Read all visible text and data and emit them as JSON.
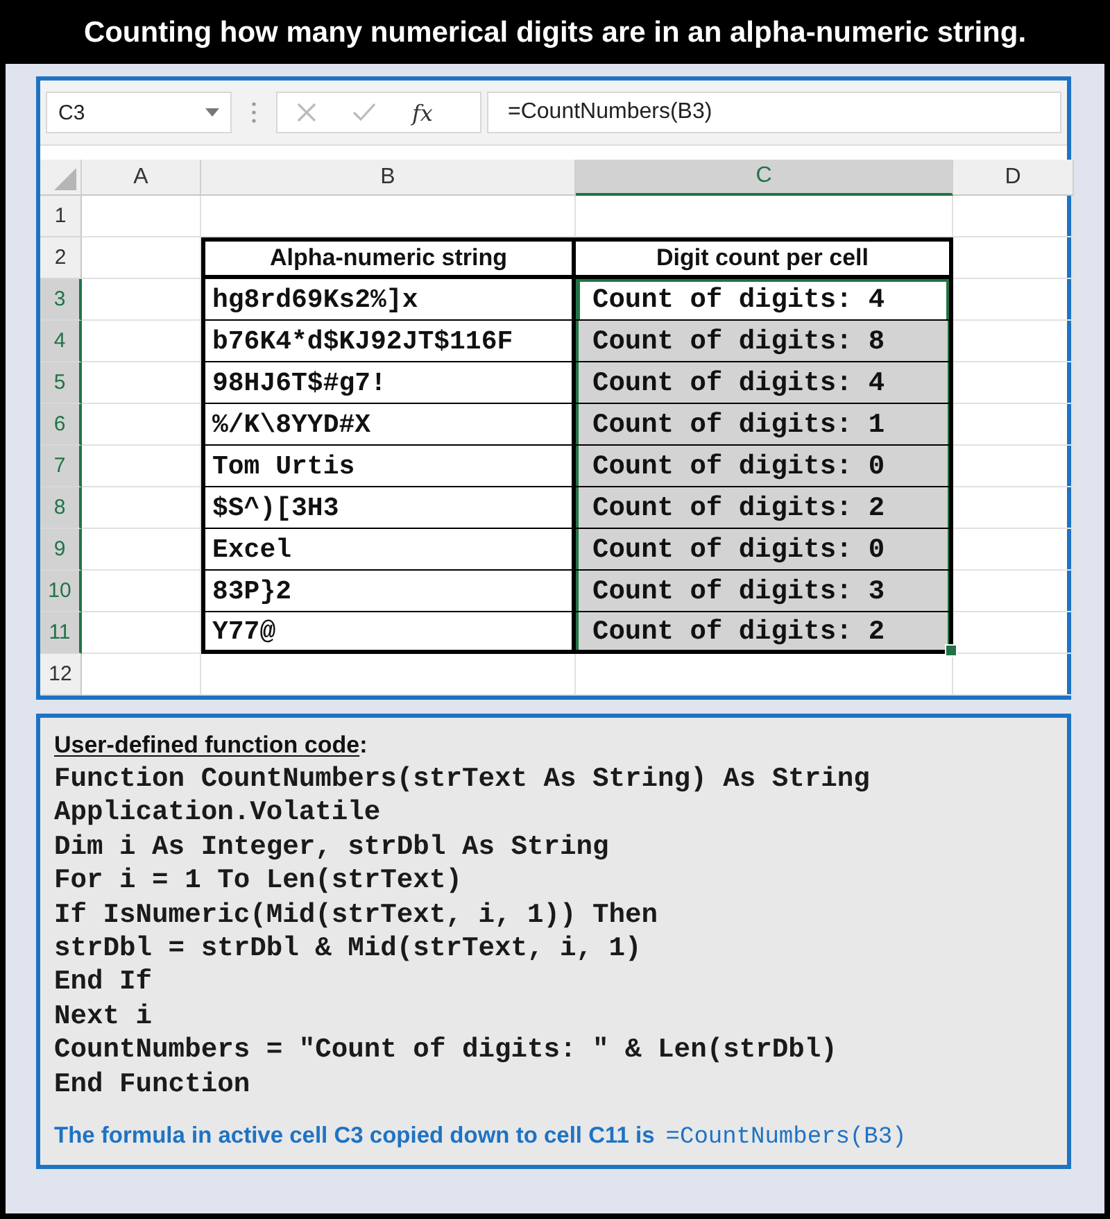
{
  "title": "Counting how many numerical digits are in an alpha-numeric string.",
  "formula_bar": {
    "name_box": "C3",
    "fx": "fx",
    "formula": "=CountNumbers(B3)"
  },
  "columns": [
    {
      "label": "A",
      "selected": false
    },
    {
      "label": "B",
      "selected": false
    },
    {
      "label": "C",
      "selected": true
    },
    {
      "label": "D",
      "selected": false
    }
  ],
  "rows": [
    {
      "number": "1",
      "kind": "empty",
      "selected": false
    },
    {
      "number": "2",
      "kind": "header",
      "selected": false,
      "cells": [
        "Alpha-numeric string",
        "Digit count per cell"
      ]
    },
    {
      "number": "3",
      "kind": "data",
      "selected": true,
      "active": true,
      "cells": [
        "hg8rd69Ks2%]x",
        "Count of digits: 4"
      ]
    },
    {
      "number": "4",
      "kind": "data",
      "selected": true,
      "active": false,
      "cells": [
        "b76K4*d$KJ92JT$116F",
        "Count of digits: 8"
      ]
    },
    {
      "number": "5",
      "kind": "data",
      "selected": true,
      "active": false,
      "cells": [
        "98HJ6T$#g7!",
        "Count of digits: 4"
      ]
    },
    {
      "number": "6",
      "kind": "data",
      "selected": true,
      "active": false,
      "cells": [
        "%/K\\8YYD#X",
        "Count of digits: 1"
      ]
    },
    {
      "number": "7",
      "kind": "data",
      "selected": true,
      "active": false,
      "cells": [
        "Tom Urtis",
        "Count of digits: 0"
      ]
    },
    {
      "number": "8",
      "kind": "data",
      "selected": true,
      "active": false,
      "cells": [
        "$S^)[3H3",
        "Count of digits: 2"
      ]
    },
    {
      "number": "9",
      "kind": "data",
      "selected": true,
      "active": false,
      "cells": [
        "Excel",
        "Count of digits: 0"
      ]
    },
    {
      "number": "10",
      "kind": "data",
      "selected": true,
      "active": false,
      "cells": [
        "83P}2",
        "Count of digits: 3"
      ]
    },
    {
      "number": "11",
      "kind": "data",
      "selected": true,
      "active": false,
      "cells": [
        "Y77@",
        "Count of digits: 2"
      ]
    },
    {
      "number": "12",
      "kind": "empty",
      "selected": false
    }
  ],
  "code": {
    "heading": "User-defined function code",
    "heading_suffix": ":",
    "lines": [
      "Function CountNumbers(strText As String) As String",
      "Application.Volatile",
      "Dim i As Integer, strDbl As String",
      "For i = 1 To Len(strText)",
      "If IsNumeric(Mid(strText, i, 1)) Then",
      "strDbl = strDbl & Mid(strText, i, 1)",
      "End If",
      "Next i",
      "CountNumbers = \"Count of digits: \" & Len(strDbl)",
      "End Function"
    ],
    "footer": "The formula in active cell C3 copied down to cell C11 is",
    "footer_formula": "=CountNumbers(B3)"
  }
}
